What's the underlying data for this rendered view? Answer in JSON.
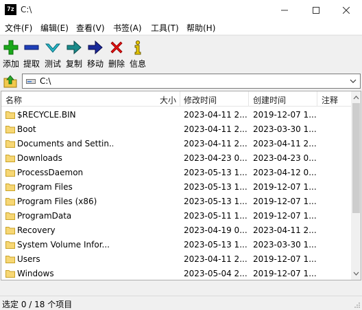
{
  "window": {
    "icon_text": "7z",
    "title": "C:\\"
  },
  "menu": [
    {
      "label": "文件(F)"
    },
    {
      "label": "编辑(E)"
    },
    {
      "label": "查看(V)"
    },
    {
      "label": "书签(A)"
    },
    {
      "label": "工具(T)"
    },
    {
      "label": "帮助(H)"
    }
  ],
  "toolbar": [
    {
      "label": "添加",
      "icon": "add-icon",
      "color": "#1aa81a"
    },
    {
      "label": "提取",
      "icon": "extract-icon",
      "color": "#1f3fb8"
    },
    {
      "label": "测试",
      "icon": "test-icon",
      "color": "#28b8c8"
    },
    {
      "label": "复制",
      "icon": "copy-icon",
      "color": "#1a8a8a"
    },
    {
      "label": "移动",
      "icon": "move-icon",
      "color": "#1a2a9a"
    },
    {
      "label": "删除",
      "icon": "delete-icon",
      "color": "#e01010"
    },
    {
      "label": "信息",
      "icon": "info-icon",
      "color": "#e8c800"
    }
  ],
  "address": {
    "path": "C:\\"
  },
  "columns": {
    "name": "名称",
    "size": "大小",
    "modified": "修改时间",
    "created": "创建时间",
    "comment": "注释"
  },
  "files": [
    {
      "name": "$RECYCLE.BIN",
      "modified": "2023-04-11 2...",
      "created": "2019-12-07 1..."
    },
    {
      "name": "Boot",
      "modified": "2023-04-11 2...",
      "created": "2023-03-30 1..."
    },
    {
      "name": "Documents and Settin...",
      "modified": "2023-04-11 2...",
      "created": "2023-04-11 2..."
    },
    {
      "name": "Downloads",
      "modified": "2023-04-23 0...",
      "created": "2023-04-23 0..."
    },
    {
      "name": "ProcessDaemon",
      "modified": "2023-05-13 1...",
      "created": "2023-04-12 0..."
    },
    {
      "name": "Program Files",
      "modified": "2023-05-13 1...",
      "created": "2019-12-07 1..."
    },
    {
      "name": "Program Files (x86)",
      "modified": "2023-05-13 1...",
      "created": "2019-12-07 1..."
    },
    {
      "name": "ProgramData",
      "modified": "2023-05-11 1...",
      "created": "2019-12-07 1..."
    },
    {
      "name": "Recovery",
      "modified": "2023-04-19 0...",
      "created": "2023-04-11 2..."
    },
    {
      "name": "System Volume Infor...",
      "modified": "2023-05-13 1...",
      "created": "2023-03-30 1..."
    },
    {
      "name": "Users",
      "modified": "2023-04-11 2...",
      "created": "2019-12-07 1..."
    },
    {
      "name": "Windows",
      "modified": "2023-05-04 2...",
      "created": "2019-12-07 1..."
    }
  ],
  "status": {
    "text": "选定 0 / 18 个项目"
  }
}
